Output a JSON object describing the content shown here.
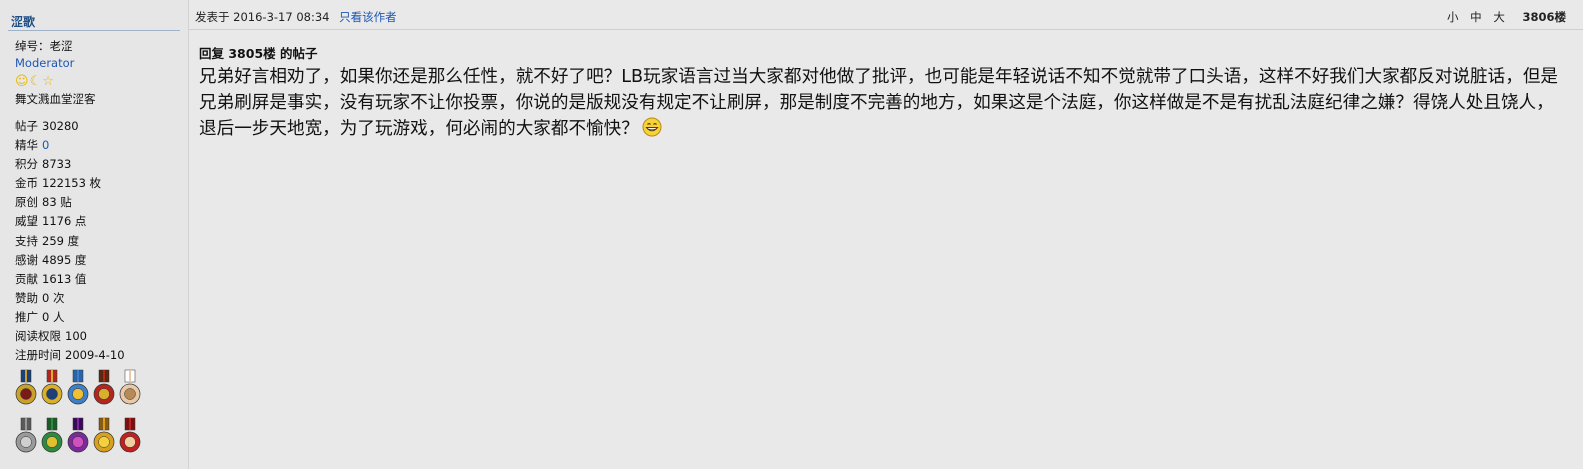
{
  "author": {
    "name": "涩歌",
    "profile": {
      "id_label": "绰号：老涩",
      "title": "Moderator",
      "rank_icons": [
        "smiley-icon",
        "moon-icon",
        "star-icon"
      ],
      "group": "舞文溅血堂涩客"
    },
    "stats": [
      {
        "label": "帖子",
        "value": "30280"
      },
      {
        "label": "精华",
        "value": "0"
      },
      {
        "label": "积分",
        "value": "8733"
      },
      {
        "label": "金币",
        "value": "122153 枚"
      },
      {
        "label": "原创",
        "value": "83 贴"
      },
      {
        "label": "威望",
        "value": "1176 点"
      },
      {
        "label": "支持",
        "value": "259 度"
      },
      {
        "label": "感谢",
        "value": "4895 度"
      },
      {
        "label": "贡献",
        "value": "1613 值"
      },
      {
        "label": "赞助",
        "value": "0 次"
      },
      {
        "label": "推广",
        "value": "0 人"
      },
      {
        "label": "阅读权限",
        "value": "100"
      },
      {
        "label": "注册时间",
        "value": "2009-4-10"
      }
    ],
    "medals": [
      [
        "medal-cross-icon",
        "medal-star-icon",
        "medal-ribbon-icon",
        "medal-red-cross-icon",
        "medal-piggy-icon"
      ],
      [
        "medal-silver-star-icon",
        "medal-green-cross-icon",
        "medal-purple-icon",
        "medal-gold-icon",
        "medal-rosette-icon"
      ]
    ]
  },
  "post": {
    "posted_at": "发表于 2016-3-17 08:34",
    "only_author": "只看该作者",
    "font_small": "小",
    "font_medium": "中",
    "font_large": "大",
    "floor": "3806楼",
    "reply_title": "回复 3805楼 的帖子",
    "body": "兄弟好言相劝了，如果你还是那么任性，就不好了吧？LB玩家语言过当大家都对他做了批评，也可能是年轻说话不知不觉就带了口头语，这样不好我们大家都反对说脏话，但是兄弟刷屏是事实，没有玩家不让你投票，你说的是版规没有规定不让刷屏，那是制度不完善的地方，如果这是个法庭，你这样做是不是有扰乱法庭纪律之嫌？得饶人处且饶人，退后一步天地宽，为了玩游戏，何必闹的大家都不愉快？",
    "emoji": "grin-icon"
  },
  "colors": {
    "background": "#e9e9e9",
    "link": "#1d57b3",
    "author": "#1e4f86"
  }
}
